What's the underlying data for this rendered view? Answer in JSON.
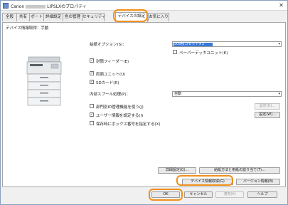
{
  "window": {
    "title_prefix": "Canon",
    "title_suffix": "LIPSLXのプロパティ",
    "close_glyph": "✕"
  },
  "tabs": [
    {
      "label": "全般"
    },
    {
      "label": "共有"
    },
    {
      "label": "ポート"
    },
    {
      "label": "詳細設定"
    },
    {
      "label": "色の管理"
    },
    {
      "label": "セキュリティ"
    },
    {
      "label": "デバイスの設定"
    },
    {
      "label": "お気に入り"
    }
  ],
  "panel": {
    "info_label": "デバイス情報取得：手動",
    "paper_option_label": "給紙オプション(S)：",
    "paper_option_value": "500枚カセット×3",
    "paper_deck_label": "ペーパーデッキユニット(K)",
    "paper_deck_checked": false,
    "bypass_feeder_label": "封筒フィーダー(E)",
    "bypass_feeder_checked": true,
    "duplex_unit_label": "両面ユニット(U)",
    "duplex_unit_checked": true,
    "sd_card_label": "SDカード(R)",
    "sd_card_checked": true,
    "spool_label": "内部スプール処理(P)：",
    "spool_value": "自動",
    "dept_id_label": "部門別ID管理機能を使う(J)",
    "dept_id_checked": false,
    "user_info_label": "ユーザー情報を設定する(I)",
    "user_info_checked": true,
    "box_number_label": "保存時にボックス番号を指定する(X)",
    "box_number_checked": false,
    "settings_button_1": "設定(D)...",
    "settings_button_2": "設定(W)...",
    "detail_settings_button": "詳細設定(Q)...",
    "paper_source_button": "給紙方法と用紙の割り当て(T)...",
    "get_device_info_button": "デバイス情報取得(G)",
    "version_info_button": "バージョン情報(B)"
  },
  "footer": {
    "ok_button": "OK",
    "cancel_button": "キャンセル",
    "apply_button": "適用(A)",
    "help_button": "ヘルプ"
  },
  "colors": {
    "highlight": "#f0901a",
    "selection": "#3a78d8"
  },
  "icons": {
    "checkmark": "✓",
    "dropdown": "▾"
  }
}
